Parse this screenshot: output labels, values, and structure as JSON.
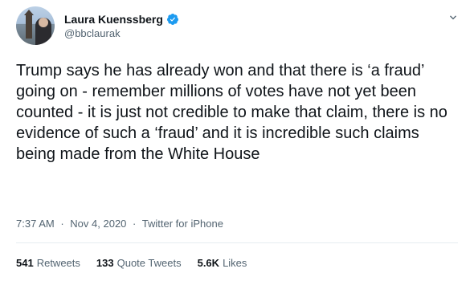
{
  "author": {
    "display_name": "Laura Kuenssberg",
    "handle": "@bbclaurak",
    "verified_icon": "verified-badge-icon"
  },
  "tweet": {
    "text": "Trump says he has already won and that there is ‘a fraud’ going on - remember millions of votes have not yet been counted - it is just not credible to make that claim, there is no evidence of such a ‘fraud’ and it is incredible such claims being made from the White House",
    "time": "7:37 AM",
    "date": "Nov 4, 2020",
    "source": "Twitter for iPhone",
    "separator": "·"
  },
  "stats": [
    {
      "count": "541",
      "label": "Retweets"
    },
    {
      "count": "133",
      "label": "Quote Tweets"
    },
    {
      "count": "5.6K",
      "label": "Likes"
    }
  ],
  "colors": {
    "accent": "#1d9bf0",
    "text": "#0f1419",
    "muted": "#536471"
  }
}
